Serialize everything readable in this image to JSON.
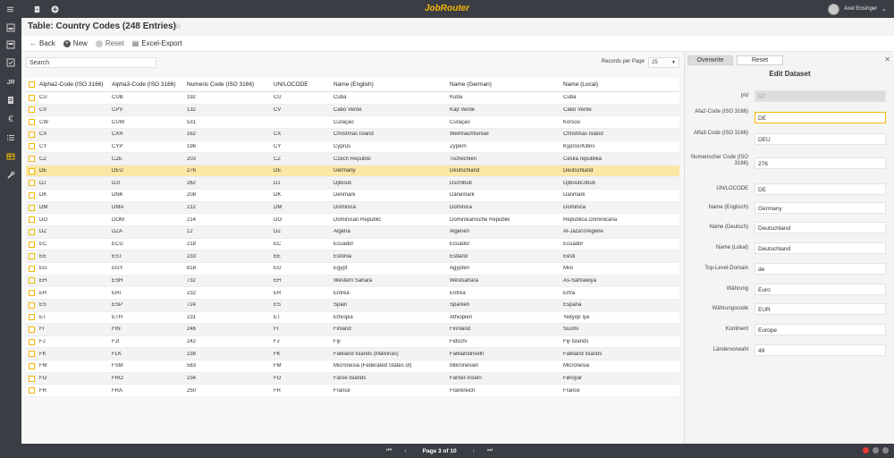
{
  "app": {
    "brand": "JobRouter",
    "user_name": "Axel Ensinger",
    "brand_color": "#f2b705"
  },
  "page": {
    "title": "Table: Country Codes (248 Entries)"
  },
  "toolbar": {
    "back_label": "Back",
    "new_label": "New",
    "reset_label": "Reset",
    "export_label": "Excel-Export"
  },
  "list": {
    "search_placeholder": "Search",
    "records_per_page_label": "Records per Page",
    "records_per_page_value": "25",
    "columns": [
      "Alpha2-Code (ISO 3166)",
      "Alpha3-Code (ISO 3166)",
      "Numeric Code (ISO 3166)",
      "UN/LOCODE",
      "Name (English)",
      "Name (German)",
      "Name (Local)"
    ],
    "rows": [
      [
        "CU",
        "CUB",
        "192",
        "CU",
        "Cuba",
        "Kuba",
        "Cuba"
      ],
      [
        "CV",
        "CPV",
        "132",
        "CV",
        "Cabo Verde",
        "Kap Verde",
        "Cabo Verde"
      ],
      [
        "CW",
        "CUW",
        "531",
        "",
        "Curaçao",
        "Curaçao",
        "Kòrsou"
      ],
      [
        "CX",
        "CXR",
        "162",
        "CX",
        "Christmas Island",
        "Weihnachtsinsel",
        "Christmas Island"
      ],
      [
        "CY",
        "CYP",
        "196",
        "CY",
        "Cyprus",
        "Zypern",
        "Kypros/Kibris"
      ],
      [
        "CZ",
        "CZE",
        "203",
        "CZ",
        "Czech Republic",
        "Tschechien",
        "Ceská republika"
      ],
      [
        "DE",
        "DEU",
        "276",
        "DE",
        "Germany",
        "Deutschland",
        "Deutschland"
      ],
      [
        "DJ",
        "DJI",
        "262",
        "DJ",
        "Djibouti",
        "Dschibuti",
        "Djibouti/Jibuti"
      ],
      [
        "DK",
        "DNK",
        "208",
        "DK",
        "Denmark",
        "Dänemark",
        "Danmark"
      ],
      [
        "DM",
        "DMA",
        "212",
        "DM",
        "Dominica",
        "Dominica",
        "Dominica"
      ],
      [
        "DO",
        "DOM",
        "214",
        "DO",
        "Dominican Republic",
        "Dominikanische Republik",
        "República Dominicana"
      ],
      [
        "DZ",
        "DZA",
        "12",
        "DZ",
        "Algeria",
        "Algerien",
        "Al-Jaza'ir/Algérie"
      ],
      [
        "EC",
        "ECU",
        "218",
        "EC",
        "Ecuador",
        "Ecuador",
        "Ecuador"
      ],
      [
        "EE",
        "EST",
        "233",
        "EE",
        "Estonia",
        "Estland",
        "Eesti"
      ],
      [
        "EG",
        "EGY",
        "818",
        "EG",
        "Egypt",
        "Ägypten",
        "Misr"
      ],
      [
        "EH",
        "ESH",
        "732",
        "EH",
        "Western Sahara",
        "Westsahara",
        "As-Sahrawiya"
      ],
      [
        "ER",
        "ERI",
        "232",
        "ER",
        "Eritrea",
        "Eritrea",
        "Ertra"
      ],
      [
        "ES",
        "ESP",
        "724",
        "ES",
        "Spain",
        "Spanien",
        "España"
      ],
      [
        "ET",
        "ETH",
        "231",
        "ET",
        "Ethiopia",
        "Äthiopien",
        "Yeityop´iya"
      ],
      [
        "FI",
        "FIN",
        "246",
        "FI",
        "Finland",
        "Finnland",
        "Suomi"
      ],
      [
        "FJ",
        "FJI",
        "242",
        "FJ",
        "Fiji",
        "Fidschi",
        "Fiji Islands"
      ],
      [
        "FK",
        "FLK",
        "238",
        "FK",
        "Falkland Islands (Malvinas)",
        "Falklandinseln",
        "Falkland Islands"
      ],
      [
        "FM",
        "FSM",
        "583",
        "FM",
        "Micronesia (Federated States of)",
        "Mikronesien",
        "Micronesia"
      ],
      [
        "FO",
        "FRO",
        "234",
        "FO",
        "Faroe Islands",
        "Färöer-Inseln",
        "Føroyar"
      ],
      [
        "FR",
        "FRA",
        "250",
        "FR",
        "France",
        "Frankreich",
        "France"
      ]
    ],
    "selected_row": 6
  },
  "panel": {
    "overwrite_label": "Overwrite",
    "reset_label": "Reset",
    "title": "Edit Dataset",
    "fields": [
      {
        "label": "jrid",
        "value": "57"
      },
      {
        "label": "Afa2-Code (ISO 3166)",
        "value": "DE"
      },
      {
        "label": "Alfa3-Code (ISO 3166)",
        "value": "DEU"
      },
      {
        "label": "Numerischer Code (ISO 3166)",
        "value": "276"
      },
      {
        "label": "UN/LOCODE",
        "value": "DE"
      },
      {
        "label": "Name (Englisch)",
        "value": "Germany"
      },
      {
        "label": "Name (Deutsch)",
        "value": "Deutschland"
      },
      {
        "label": "Name (Lokal)",
        "value": "Deutschland"
      },
      {
        "label": "Top-Level-Domain",
        "value": "de"
      },
      {
        "label": "Währung",
        "value": "Euro"
      },
      {
        "label": "Währungscode",
        "value": "EUR"
      },
      {
        "label": "Kontinent",
        "value": "Europe"
      },
      {
        "label": "Ländervorwahl",
        "value": "49"
      }
    ]
  },
  "pager": {
    "label": "Page 3 of 10"
  },
  "status_dots": [
    "#e53935",
    "#888888",
    "#888888"
  ]
}
